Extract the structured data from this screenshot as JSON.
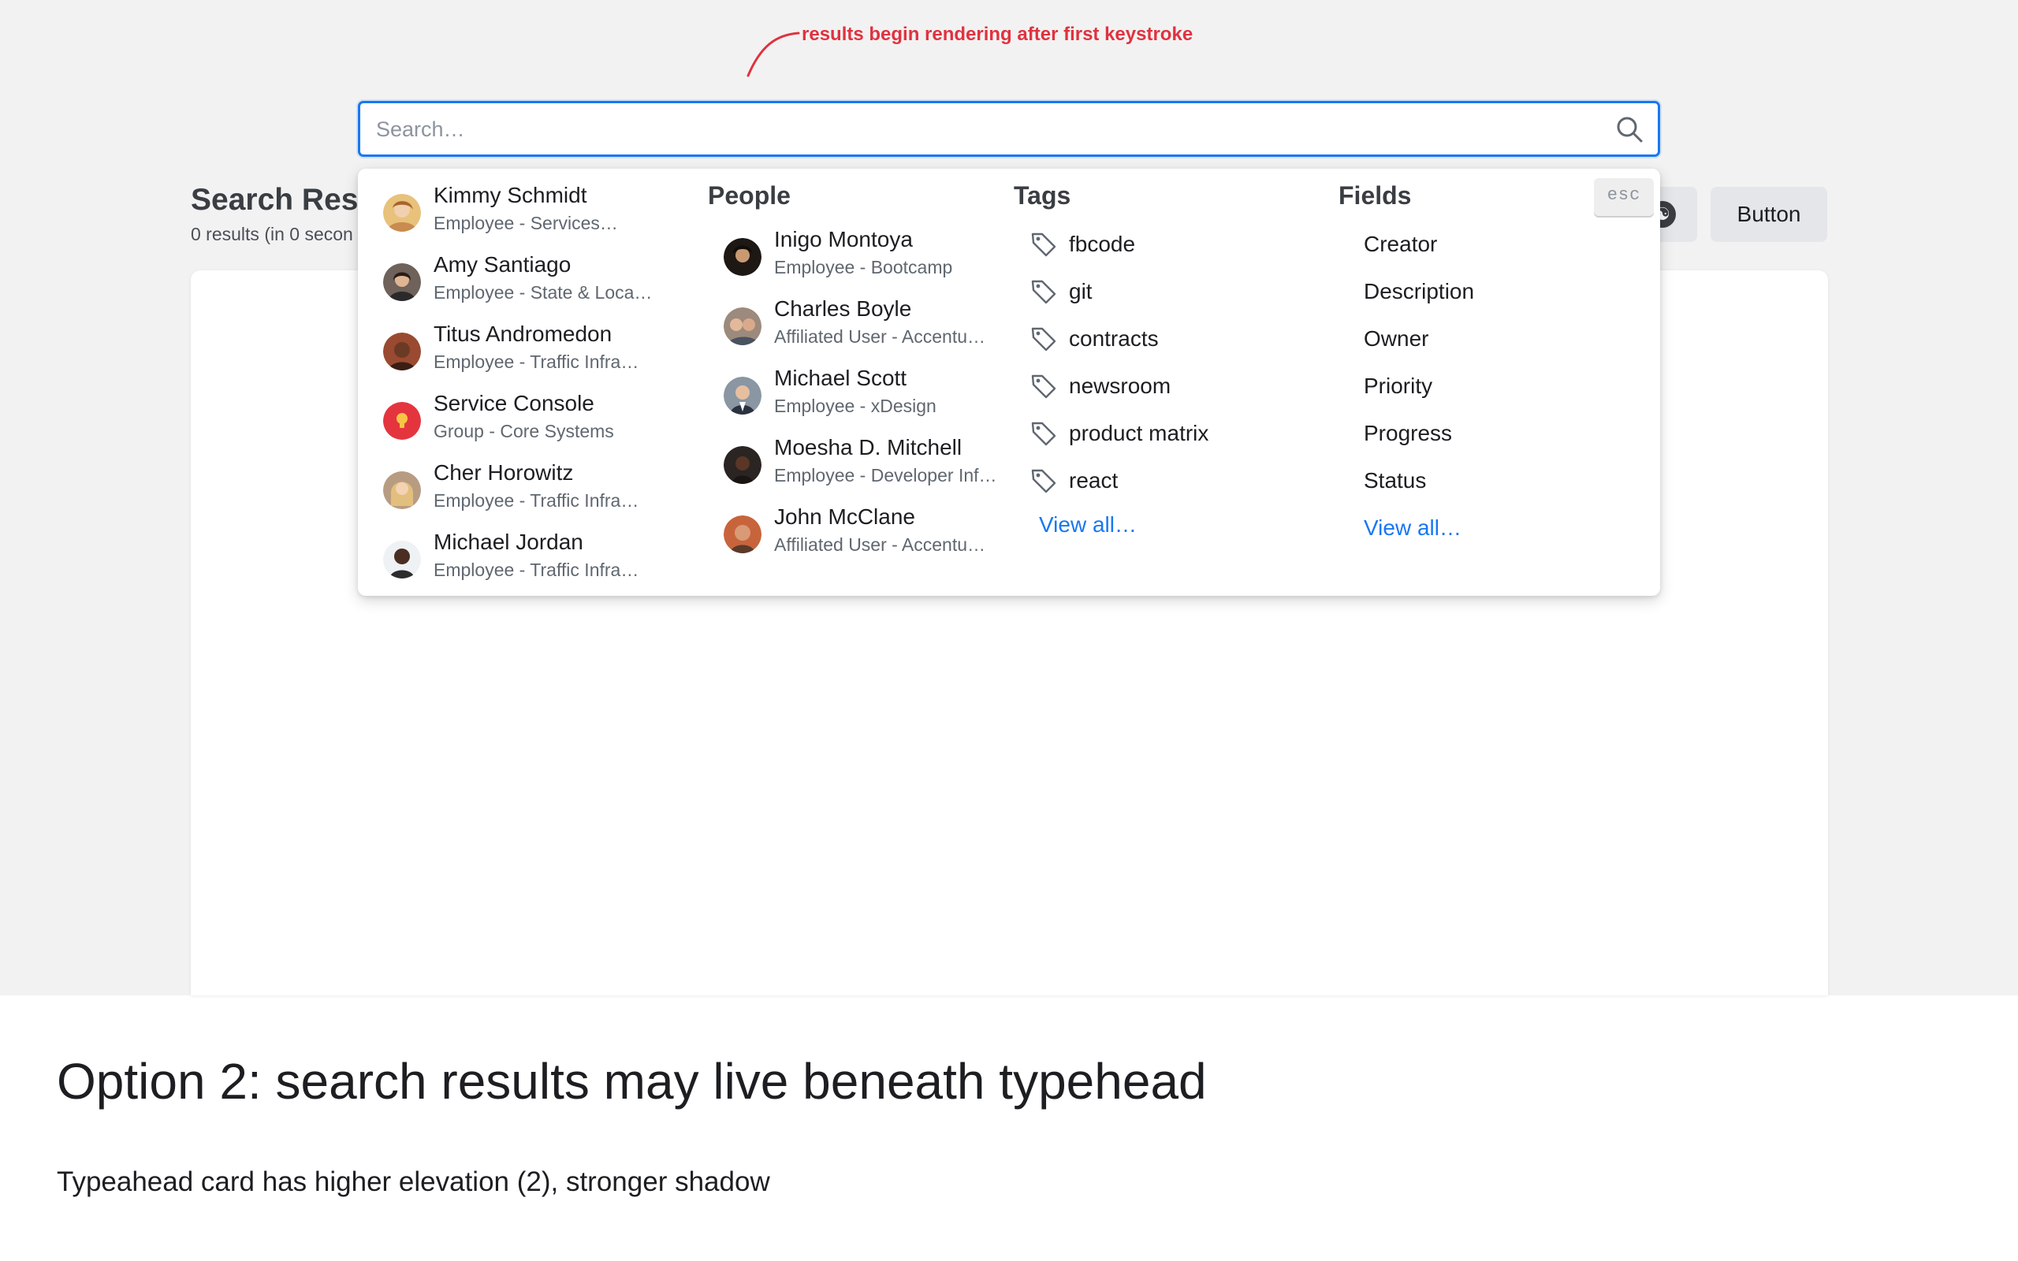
{
  "annotation": {
    "text": "results begin rendering after first keystroke",
    "color": "#e0323f"
  },
  "page": {
    "title": "Search Resu",
    "subtitle": "0 results (in 0 secon",
    "button_label": "Button"
  },
  "search": {
    "placeholder": "Search…",
    "value": "",
    "accent": "#1877f2"
  },
  "dropdown": {
    "esc_label": "esc",
    "top_results": [
      {
        "name": "Kimmy Schmidt",
        "sub": "Employee - Services…",
        "avatar": "kimmy-avatar",
        "color": "#c98b4f"
      },
      {
        "name": "Amy Santiago",
        "sub": "Employee - State & Loca…",
        "avatar": "amy-avatar",
        "color": "#5a4a44"
      },
      {
        "name": "Titus Andromedon",
        "sub": "Employee - Traffic Infra…",
        "avatar": "titus-avatar",
        "color": "#7a3b2a"
      },
      {
        "name": "Service Console",
        "sub": "Group - Core Systems",
        "avatar": "service-console-icon",
        "color": "#e4353f"
      },
      {
        "name": "Cher Horowitz",
        "sub": "Employee - Traffic Infra…",
        "avatar": "cher-avatar",
        "color": "#d8b27a"
      },
      {
        "name": "Michael Jordan",
        "sub": "Employee - Traffic Infra…",
        "avatar": "michael-jordan-avatar",
        "color": "#3b2a22"
      }
    ],
    "people": {
      "title": "People",
      "items": [
        {
          "name": "Inigo Montoya",
          "sub": "Employee - Bootcamp",
          "avatar": "inigo-avatar",
          "color": "#3a2a20"
        },
        {
          "name": "Charles Boyle",
          "sub": "Affiliated User - Accentu…",
          "avatar": "charles-avatar",
          "color": "#8a7060"
        },
        {
          "name": "Michael Scott",
          "sub": "Employee - xDesign",
          "avatar": "michael-scott-avatar",
          "color": "#556070"
        },
        {
          "name": "Moesha D. Mitchell",
          "sub": "Employee - Developer Inf…",
          "avatar": "moesha-avatar",
          "color": "#3a2620"
        },
        {
          "name": "John McClane",
          "sub": "Affiliated User - Accentu…",
          "avatar": "john-avatar",
          "color": "#b0603c"
        }
      ]
    },
    "tags": {
      "title": "Tags",
      "items": [
        "fbcode",
        "git",
        "contracts",
        "newsroom",
        "product matrix",
        "react"
      ],
      "view_all": "View all…"
    },
    "fields": {
      "title": "Fields",
      "items": [
        "Creator",
        "Description",
        "Owner",
        "Priority",
        "Progress",
        "Status"
      ],
      "view_all": "View all…"
    }
  },
  "caption": {
    "title": "Option 2: search results may live beneath typehead",
    "body": "Typeahead card has higher elevation (2), stronger shadow"
  }
}
